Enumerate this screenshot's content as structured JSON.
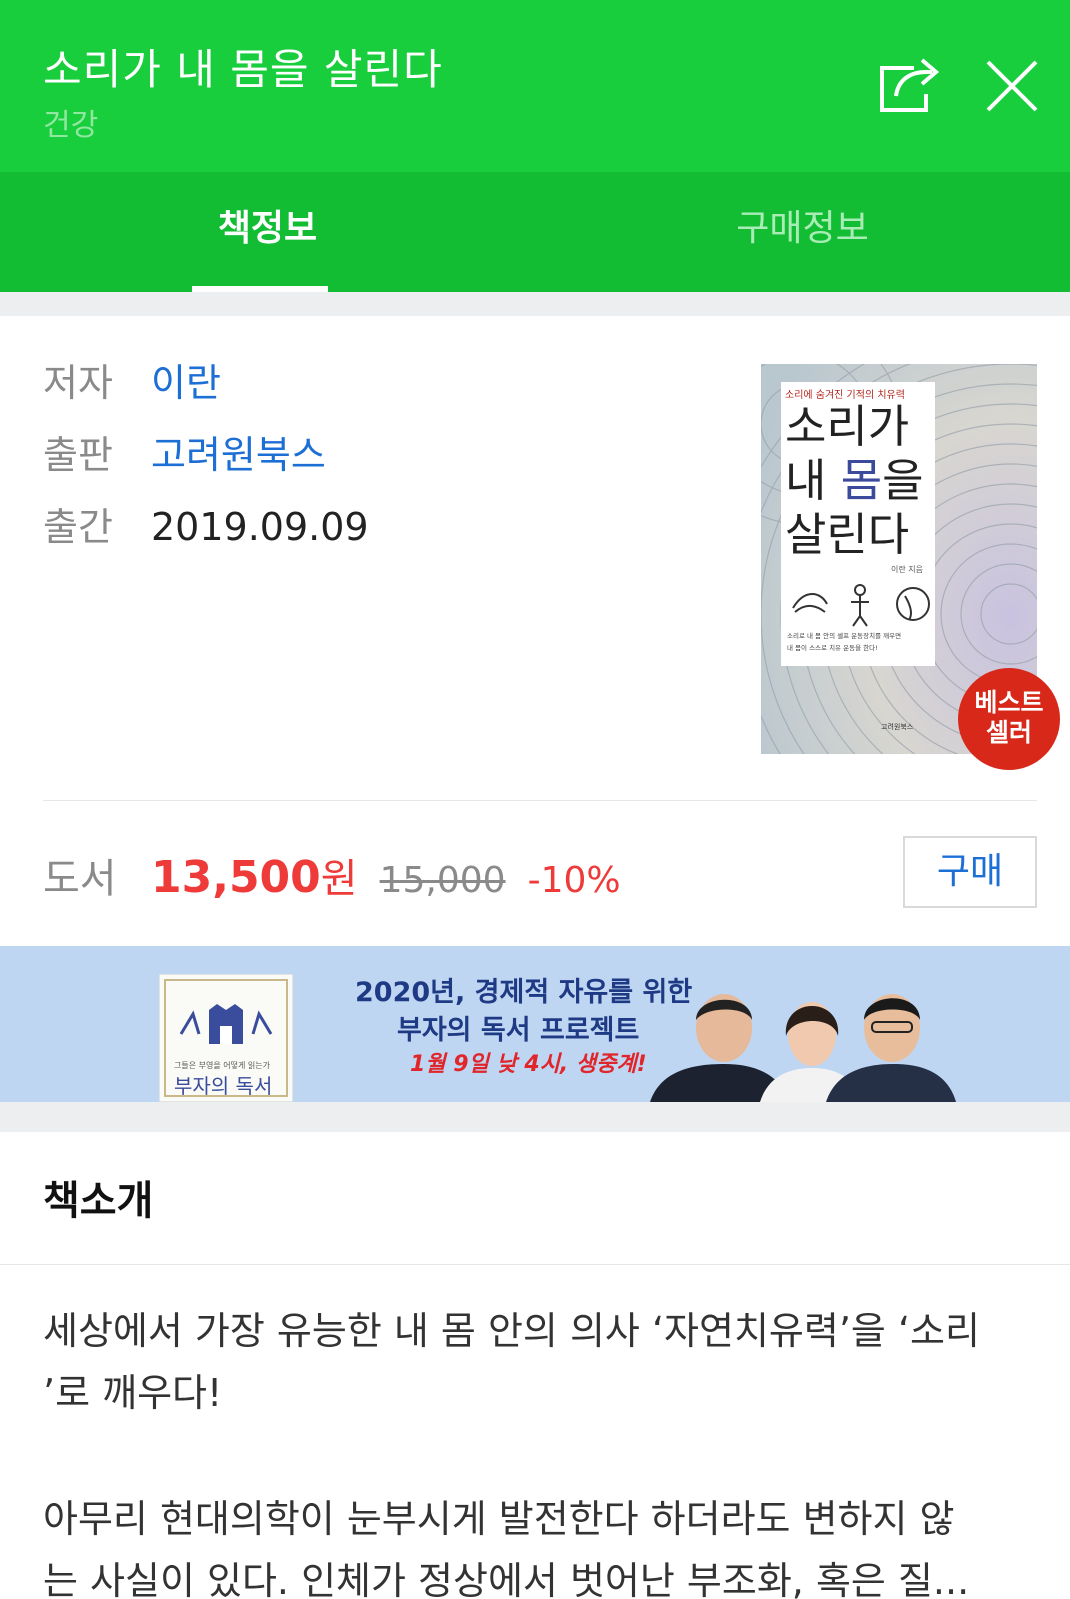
{
  "header": {
    "title": "소리가 내 몸을 살린다",
    "category": "건강",
    "share_icon": "share-icon",
    "close_icon": "close-icon"
  },
  "tabs": [
    {
      "label": "책정보",
      "active": true
    },
    {
      "label": "구매정보",
      "active": false
    }
  ],
  "info": {
    "author_label": "저자",
    "author": "이란",
    "publisher_label": "출판",
    "publisher": "고려원북스",
    "date_label": "출간",
    "date": "2019.09.09"
  },
  "cover": {
    "top_text": "소리에 숨겨진 기적의 치유력",
    "line1": "소리가",
    "line2a": "내 ",
    "line2b": "몸",
    "line2c": "을",
    "line3": "살린다",
    "author_small": "이란 지음",
    "caption1": "소리로 내 몸 안의 셀프 운동장치를 깨우면",
    "caption2": "내 몸이 스스로 치유 운동을 한다!",
    "publisher_small": "고려원북스"
  },
  "badge": {
    "line1": "베스트",
    "line2": "셀러"
  },
  "price": {
    "label": "도서",
    "sale": "13,500",
    "won": "원",
    "original": "15,000",
    "discount": "-10%",
    "buy_label": "구매"
  },
  "banner": {
    "line1": "2020년, 경제적 자유를 위한",
    "line2": "부자의 독서 프로젝트",
    "line3": "1월 9일 낮 4시, 생중계!",
    "book_small": "그들은 부영을 어떻게 읽는가",
    "book_title": "부자의 독서"
  },
  "intro": {
    "title": "책소개",
    "para1_line1": "세상에서 가장 유능한 내 몸 안의 의사 ‘자연치유력’을 ‘소리",
    "para1_line2": "’로 깨우다!",
    "para2_line1": "아무리 현대의학이 눈부시게 발전한다 하더라도 변하지 않",
    "para2_line2": "는 사실이 있다. 인체가 정상에서 벗어난 부조화, 혹은 질..."
  },
  "colors": {
    "brand_green": "#19ce3d",
    "tab_green": "#12bc33",
    "link_blue": "#1d6fd6",
    "price_red": "#ef3a3a",
    "badge_red": "#d7281a",
    "banner_bg": "#bfd6f2"
  }
}
